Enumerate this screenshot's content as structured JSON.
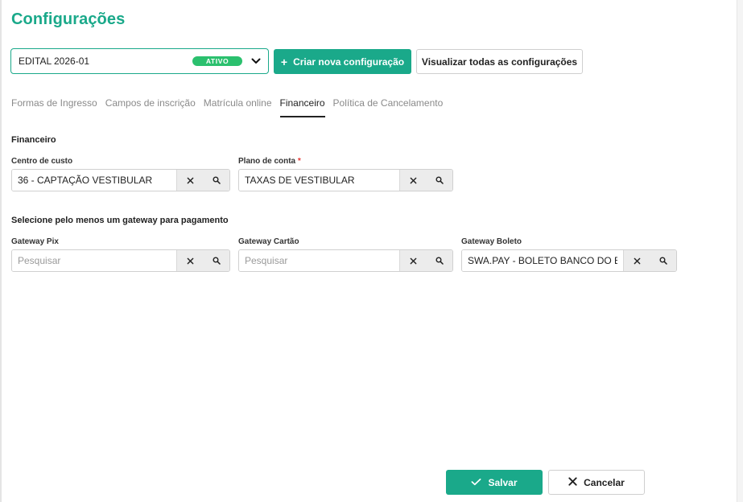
{
  "page": {
    "title": "Configurações"
  },
  "config_selector": {
    "value": "EDITAL 2026-01",
    "status": "ATIVO",
    "status_color": "#2bc06e"
  },
  "toolbar": {
    "create_label": "Criar nova configuração",
    "create_icon": "+",
    "view_all_label": "Visualizar todas as configurações"
  },
  "tabs": [
    {
      "label": "Formas de Ingresso",
      "active": false
    },
    {
      "label": "Campos de inscrição",
      "active": false
    },
    {
      "label": "Matrícula online",
      "active": false
    },
    {
      "label": "Financeiro",
      "active": true
    },
    {
      "label": "Política de Cancelamento",
      "active": false
    }
  ],
  "financeiro": {
    "title": "Financeiro",
    "centro_custo": {
      "label": "Centro de custo",
      "value": "36 - CAPTAÇÃO VESTIBULAR",
      "placeholder": ""
    },
    "plano_conta": {
      "label": "Plano de conta",
      "required_mark": "*",
      "value": "TAXAS DE VESTIBULAR",
      "placeholder": ""
    }
  },
  "gateways": {
    "title": "Selecione pelo menos um gateway para pagamento",
    "pix": {
      "label": "Gateway Pix",
      "value": "",
      "placeholder": "Pesquisar"
    },
    "cartao": {
      "label": "Gateway Cartão",
      "value": "",
      "placeholder": "Pesquisar"
    },
    "boleto": {
      "label": "Gateway Boleto",
      "value": "SWA.PAY - BOLETO BANCO DO BR",
      "placeholder": "Pesquisar"
    }
  },
  "footer": {
    "save_label": "Salvar",
    "cancel_label": "Cancelar"
  },
  "colors": {
    "accent": "#1aa98a",
    "required": "#e53935"
  },
  "icons": {
    "clear": "close-icon",
    "search": "search-icon",
    "chevron": "chevron-down-icon",
    "check": "check-icon"
  }
}
